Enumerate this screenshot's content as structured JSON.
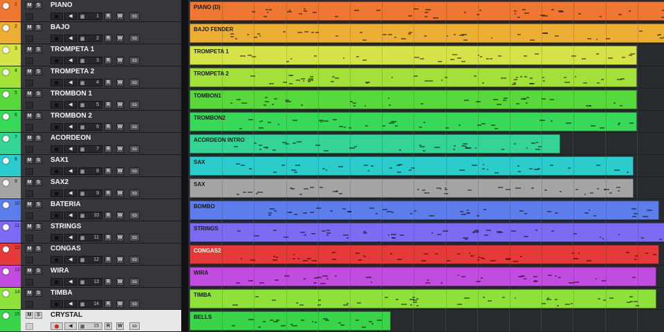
{
  "tracks": [
    {
      "num": "1",
      "name": "PIANO",
      "color": "#ee7732",
      "channel": "1",
      "selected": false
    },
    {
      "num": "2",
      "name": "BAJO",
      "color": "#ecae34",
      "channel": "2",
      "selected": false
    },
    {
      "num": "3",
      "name": "TROMPETA 1",
      "color": "#d4e448",
      "channel": "3",
      "selected": false
    },
    {
      "num": "4",
      "name": "TROMPETA 2",
      "color": "#a3e03a",
      "channel": "4",
      "selected": false
    },
    {
      "num": "5",
      "name": "TROMBON 1",
      "color": "#58d83a",
      "channel": "5",
      "selected": false
    },
    {
      "num": "6",
      "name": "TROMBON 2",
      "color": "#3ad85a",
      "channel": "6",
      "selected": false
    },
    {
      "num": "7",
      "name": "ACORDEON",
      "color": "#33d494",
      "channel": "7",
      "selected": false
    },
    {
      "num": "8",
      "name": "SAX1",
      "color": "#2ccbcc",
      "channel": "8",
      "selected": false
    },
    {
      "num": "9",
      "name": "SAX2",
      "color": "#a4a4a4",
      "channel": "9",
      "selected": false
    },
    {
      "num": "10",
      "name": "BATERIA",
      "color": "#5d7eea",
      "channel": "10",
      "selected": false
    },
    {
      "num": "11",
      "name": "STRINGS",
      "color": "#7d6bf4",
      "channel": "11",
      "selected": false
    },
    {
      "num": "12",
      "name": "CONGAS",
      "color": "#e43a3a",
      "channel": "12",
      "selected": false
    },
    {
      "num": "13",
      "name": "WIRA",
      "color": "#c24ce0",
      "channel": "13",
      "selected": false
    },
    {
      "num": "14",
      "name": "TIMBA",
      "color": "#8ee03a",
      "channel": "14",
      "selected": false
    },
    {
      "num": "15",
      "name": "CRYSTAL",
      "color": "#3ad44a",
      "channel": "15",
      "selected": true
    }
  ],
  "buttons": {
    "mute": "M",
    "solo": "S",
    "read": "R",
    "write": "W",
    "edit": "▭",
    "monitor": "◀",
    "grid": "▦"
  },
  "parts": [
    {
      "track": 1,
      "label": "PIANO (D)",
      "color": "#ee7732",
      "start_bar": 0,
      "end_bar": 15.4,
      "light": false
    },
    {
      "track": 2,
      "label": "BAJO FENDER",
      "color": "#ecae34",
      "start_bar": 0,
      "end_bar": 15.4,
      "light": false
    },
    {
      "track": 3,
      "label": "TROMPETA 1",
      "color": "#d4e448",
      "start_bar": 0,
      "end_bar": 14.0,
      "light": false
    },
    {
      "track": 4,
      "label": "TROMPETA 2",
      "color": "#a3e03a",
      "start_bar": 0,
      "end_bar": 14.0,
      "light": false
    },
    {
      "track": 5,
      "label": "TOMBON1",
      "color": "#58d83a",
      "start_bar": 0,
      "end_bar": 14.0,
      "light": false
    },
    {
      "track": 6,
      "label": "TROMBON2",
      "color": "#3ad85a",
      "start_bar": 0,
      "end_bar": 14.0,
      "light": false
    },
    {
      "track": 7,
      "label": "ACORDEON INTRO",
      "color": "#33d494",
      "start_bar": 0,
      "end_bar": 11.6,
      "light": false
    },
    {
      "track": 8,
      "label": "SAX",
      "color": "#2ccbcc",
      "start_bar": 0,
      "end_bar": 13.9,
      "light": false
    },
    {
      "track": 9,
      "label": "SAX",
      "color": "#a4a4a4",
      "start_bar": 0,
      "end_bar": 13.9,
      "light": false
    },
    {
      "track": 10,
      "label": "BOMBO",
      "color": "#5d7eea",
      "start_bar": 0,
      "end_bar": 14.7,
      "light": false
    },
    {
      "track": 11,
      "label": "STRINGS",
      "color": "#7d6bf4",
      "start_bar": 0,
      "end_bar": 15.4,
      "light": false
    },
    {
      "track": 12,
      "label": "CONGAS2",
      "color": "#e43a3a",
      "start_bar": 0,
      "end_bar": 14.7,
      "light": true
    },
    {
      "track": 13,
      "label": "WIRA",
      "color": "#c24ce0",
      "start_bar": 0,
      "end_bar": 14.6,
      "light": false
    },
    {
      "track": 14,
      "label": "TIMBA",
      "color": "#8ee03a",
      "start_bar": 0,
      "end_bar": 14.6,
      "light": false
    },
    {
      "track": 15,
      "label": "BELLS",
      "color": "#3ad44a",
      "start_bar": 0,
      "end_bar": 6.3,
      "light": false
    }
  ]
}
